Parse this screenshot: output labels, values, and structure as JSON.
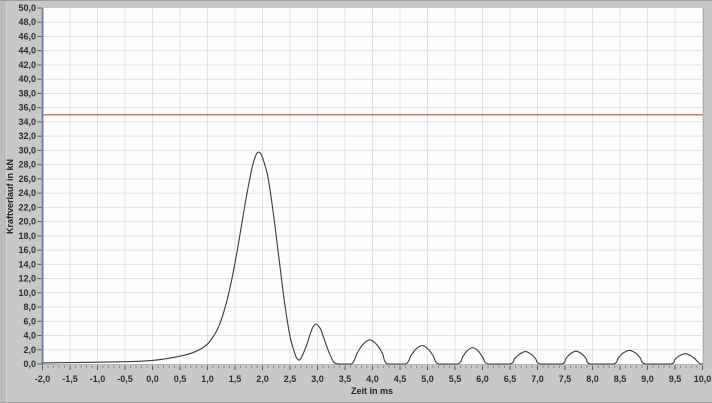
{
  "window": {
    "background": "#c8c8c8"
  },
  "colors": {
    "panel": "#c8c8c8",
    "plot_bg": "#fdfdfd",
    "grid": "#e2e2e2",
    "axis_line": "#7383a6",
    "baseline": "#b5b5b5",
    "tick": "#5a5a5a",
    "minor_tick": "#8a8a8a",
    "tick_label": "#2e2e2e",
    "curve": "#3c3c3c",
    "limit": "#c0504d",
    "plot_right_border": "#b0b0b0"
  },
  "chart_data": {
    "type": "line",
    "title": "",
    "xlabel": "Zeit in ms",
    "ylabel": "Kraftverlauf in kN",
    "xlim": [
      -2,
      10
    ],
    "ylim": [
      0,
      50
    ],
    "grid": true,
    "x_minor_tick_step": 0.1,
    "x_tick_values": [
      -2.0,
      -1.5,
      -1.0,
      -0.5,
      0.0,
      0.5,
      1.0,
      1.5,
      2.0,
      2.5,
      3.0,
      3.5,
      4.0,
      4.5,
      5.0,
      5.5,
      6.0,
      6.5,
      7.0,
      7.5,
      8.0,
      8.5,
      9.0,
      9.5,
      10.0
    ],
    "x_tick_labels": [
      "-2,0",
      "-1,5",
      "-1,0",
      "-0,5",
      "0,0",
      "0,5",
      "1,0",
      "1,5",
      "2,0",
      "2,5",
      "3,0",
      "3,5",
      "4,0",
      "4,5",
      "5,0",
      "5,5",
      "6,0",
      "6,5",
      "7,0",
      "7,5",
      "8,0",
      "8,5",
      "9,0",
      "9,5",
      "10,0"
    ],
    "y_tick_values": [
      0,
      2,
      4,
      6,
      8,
      10,
      12,
      14,
      16,
      18,
      20,
      22,
      24,
      26,
      28,
      30,
      32,
      34,
      36,
      38,
      40,
      42,
      44,
      46,
      48,
      50
    ],
    "y_tick_labels": [
      "0,0",
      "2,0",
      "4,0",
      "6,0",
      "8,0",
      "10,0",
      "12,0",
      "14,0",
      "16,0",
      "18,0",
      "20,0",
      "22,0",
      "24,0",
      "26,0",
      "28,0",
      "30,0",
      "32,0",
      "34,0",
      "36,0",
      "38,0",
      "40,0",
      "42,0",
      "44,0",
      "46,0",
      "48,0",
      "50,0"
    ],
    "threshold_line": {
      "value": 35,
      "color": "#c0504d"
    },
    "series": [
      {
        "name": "Kraftverlauf",
        "color": "#3c3c3c",
        "points": [
          [
            -2.0,
            0.15
          ],
          [
            -1.5,
            0.2
          ],
          [
            -1.0,
            0.25
          ],
          [
            -0.5,
            0.32
          ],
          [
            -0.2,
            0.4
          ],
          [
            0.0,
            0.5
          ],
          [
            0.25,
            0.75
          ],
          [
            0.5,
            1.1
          ],
          [
            0.7,
            1.5
          ],
          [
            0.85,
            2.0
          ],
          [
            1.0,
            2.8
          ],
          [
            1.1,
            3.8
          ],
          [
            1.2,
            5.2
          ],
          [
            1.3,
            7.4
          ],
          [
            1.4,
            10.4
          ],
          [
            1.5,
            14.2
          ],
          [
            1.6,
            18.6
          ],
          [
            1.7,
            23.2
          ],
          [
            1.8,
            27.2
          ],
          [
            1.85,
            28.7
          ],
          [
            1.9,
            29.6
          ],
          [
            1.95,
            29.7
          ],
          [
            2.0,
            29.0
          ],
          [
            2.1,
            26.2
          ],
          [
            2.2,
            21.0
          ],
          [
            2.3,
            14.8
          ],
          [
            2.4,
            8.7
          ],
          [
            2.5,
            3.9
          ],
          [
            2.6,
            1.2
          ],
          [
            2.65,
            0.6
          ],
          [
            2.7,
            0.8
          ],
          [
            2.8,
            2.6
          ],
          [
            2.9,
            4.9
          ],
          [
            2.97,
            5.6
          ],
          [
            3.05,
            5.0
          ],
          [
            3.1,
            4.0
          ],
          [
            3.2,
            1.8
          ],
          [
            3.3,
            0.2
          ],
          [
            3.4,
            0
          ],
          [
            3.62,
            0
          ],
          [
            3.72,
            1.5
          ],
          [
            3.82,
            2.7
          ],
          [
            3.95,
            3.4
          ],
          [
            4.08,
            2.7
          ],
          [
            4.18,
            1.5
          ],
          [
            4.27,
            0
          ],
          [
            4.6,
            0
          ],
          [
            4.7,
            1.2
          ],
          [
            4.79,
            2.1
          ],
          [
            4.9,
            2.6
          ],
          [
            5.01,
            2.1
          ],
          [
            5.1,
            1.2
          ],
          [
            5.2,
            0
          ],
          [
            5.55,
            0
          ],
          [
            5.64,
            1.0
          ],
          [
            5.72,
            1.85
          ],
          [
            5.82,
            2.3
          ],
          [
            5.92,
            1.85
          ],
          [
            6.0,
            1.0
          ],
          [
            6.1,
            0
          ],
          [
            6.5,
            0
          ],
          [
            6.59,
            0.8
          ],
          [
            6.68,
            1.4
          ],
          [
            6.78,
            1.75
          ],
          [
            6.88,
            1.4
          ],
          [
            6.96,
            0.8
          ],
          [
            7.05,
            0
          ],
          [
            7.44,
            0
          ],
          [
            7.52,
            0.8
          ],
          [
            7.6,
            1.45
          ],
          [
            7.7,
            1.8
          ],
          [
            7.8,
            1.45
          ],
          [
            7.88,
            0.8
          ],
          [
            7.96,
            0
          ],
          [
            8.38,
            0
          ],
          [
            8.47,
            0.85
          ],
          [
            8.56,
            1.55
          ],
          [
            8.67,
            1.9
          ],
          [
            8.78,
            1.55
          ],
          [
            8.87,
            0.85
          ],
          [
            8.96,
            0
          ],
          [
            9.42,
            0
          ],
          [
            9.5,
            0.65
          ],
          [
            9.58,
            1.15
          ],
          [
            9.69,
            1.45
          ],
          [
            9.79,
            1.15
          ],
          [
            9.87,
            0.65
          ],
          [
            9.96,
            0
          ],
          [
            10.0,
            0
          ]
        ]
      }
    ]
  }
}
